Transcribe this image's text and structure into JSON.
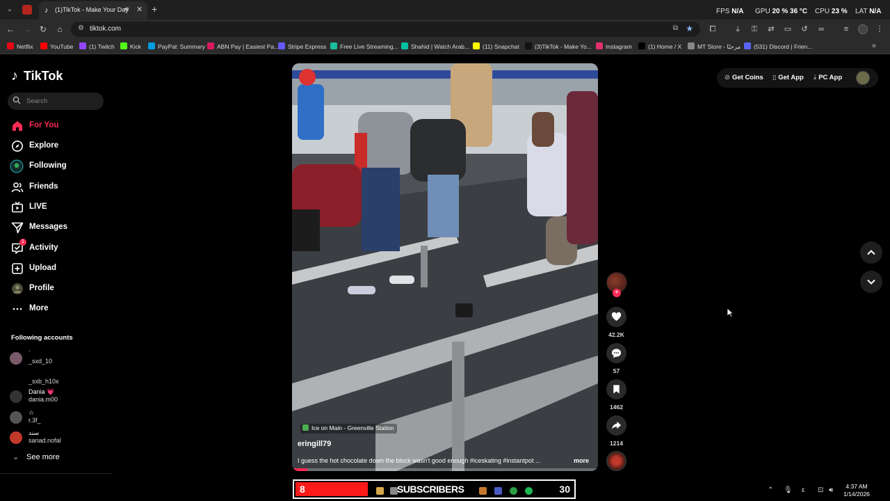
{
  "browser": {
    "active_tab_title": "(1)TikTok - Make Your Day",
    "url": "tiktok.com",
    "hud": {
      "fps_label": "FPS",
      "fps_value": "N/A",
      "gpu_label": "GPU",
      "gpu_value": "20 % 36 °C",
      "cpu_label": "CPU",
      "cpu_value": "23 %",
      "lat_label": "LAT",
      "lat_value": "N/A"
    },
    "bookmarks": [
      {
        "label": "Netflix",
        "color": "#e50914"
      },
      {
        "label": "YouTube",
        "color": "#ff0000"
      },
      {
        "label": "(1) Twitch",
        "color": "#9146ff"
      },
      {
        "label": "Kick",
        "color": "#53fc18"
      },
      {
        "label": "PayPal: Summary",
        "color": "#009cde"
      },
      {
        "label": "ABN Pay | Easiest Pa...",
        "color": "#d81b60"
      },
      {
        "label": "Stripe Express",
        "color": "#635bff"
      },
      {
        "label": "Free Live Streaming...",
        "color": "#1abc9c"
      },
      {
        "label": "Shahid | Watch Arab...",
        "color": "#00bfa5"
      },
      {
        "label": "(11) Snapchat",
        "color": "#fffc00"
      },
      {
        "label": "(3)TikTok - Make Yo...",
        "color": "#111111"
      },
      {
        "label": "Instagram",
        "color": "#e1306c"
      },
      {
        "label": "(1) Home / X",
        "color": "#000000"
      },
      {
        "label": "MT Store - مرحبًا",
        "color": "#888888"
      },
      {
        "label": "(531) Discord | Frien...",
        "color": "#5865f2"
      }
    ]
  },
  "sidebar": {
    "brand": "TikTok",
    "search_placeholder": "Search",
    "nav": [
      {
        "label": "For You",
        "icon": "home-icon"
      },
      {
        "label": "Explore",
        "icon": "compass-icon"
      },
      {
        "label": "Following",
        "icon": "following-avatar-icon"
      },
      {
        "label": "Friends",
        "icon": "friends-icon"
      },
      {
        "label": "LIVE",
        "icon": "live-icon"
      },
      {
        "label": "Messages",
        "icon": "messages-icon"
      },
      {
        "label": "Activity",
        "icon": "activity-icon",
        "badge": "1"
      },
      {
        "label": "Upload",
        "icon": "upload-icon"
      },
      {
        "label": "Profile",
        "icon": "profile-avatar-icon"
      },
      {
        "label": "More",
        "icon": "more-icon"
      }
    ],
    "following_title": "Following accounts",
    "accounts": [
      {
        "name": ".",
        "handle": "_sxd_10",
        "color": "#7a5a6a"
      },
      {
        "name": "",
        "handle": "_sxb_h10x",
        "color": "#000000"
      },
      {
        "name": "Dania 💗",
        "handle": "dania.m00",
        "color": "#333333"
      },
      {
        "name": "☆",
        "handle": "r.3f_",
        "color": "#555555"
      },
      {
        "name": "سند",
        "handle": "sanad.nofal",
        "color": "#c0392b"
      }
    ],
    "see_more": "See more"
  },
  "video": {
    "location": "Ice on Main - Greenville Station",
    "author": "eringill79",
    "caption": "I guess the hot chocolate down the block wasn't good enough #iceskating #instantpot ...",
    "caption_more": "more",
    "progress": 0.05
  },
  "actions": {
    "likes": "42.2K",
    "comments": "57",
    "saves": "1462",
    "shares": "1214"
  },
  "topbar": {
    "get_coins": "Get Coins",
    "get_app": "Get App",
    "pc_app": "PC App"
  },
  "taskbar": {
    "sub_left": "8",
    "sub_label": "SUBSCRIBERS",
    "sub_right": "30",
    "time": "4:37 AM",
    "date": "1/14/2026"
  }
}
